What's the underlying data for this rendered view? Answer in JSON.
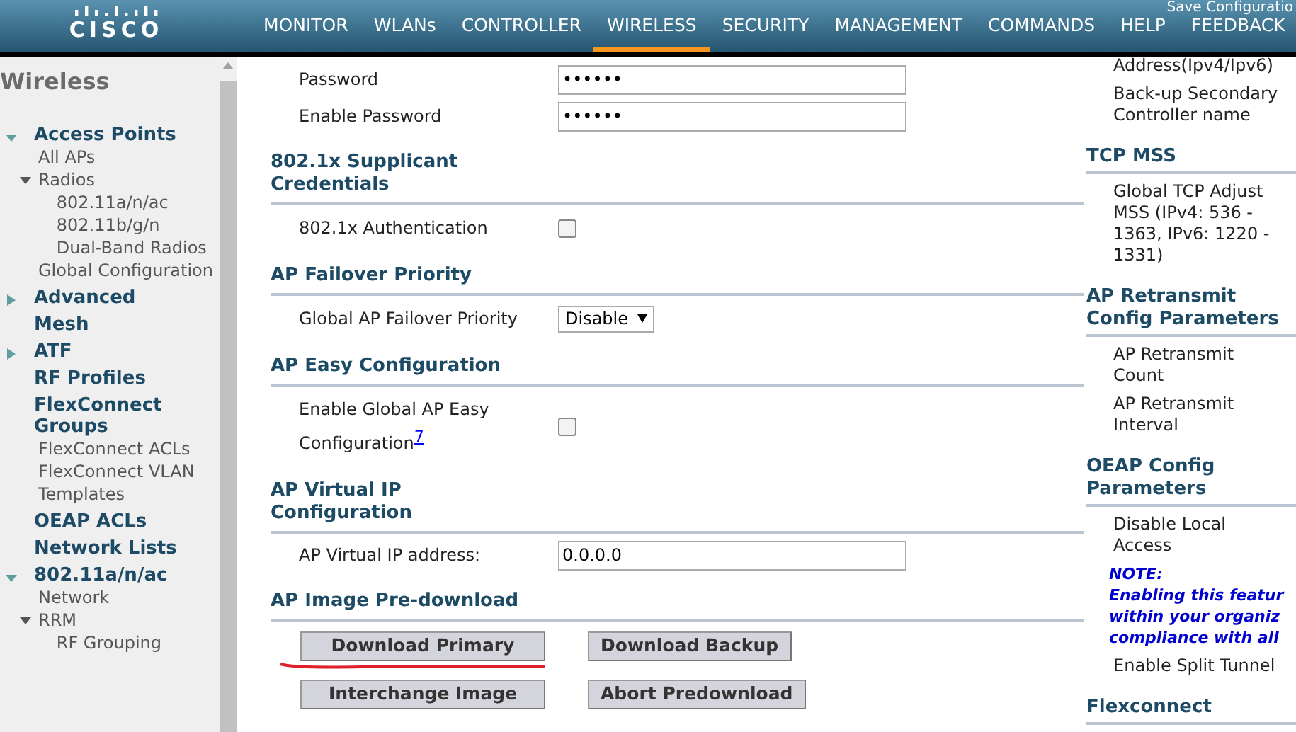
{
  "header": {
    "logo_text": "CISCO",
    "save_link": "Save Configuratio",
    "nav": [
      {
        "label": "MONITOR",
        "selected": false
      },
      {
        "label": "WLANs",
        "selected": false
      },
      {
        "label": "CONTROLLER",
        "selected": false
      },
      {
        "label": "WIRELESS",
        "selected": true
      },
      {
        "label": "SECURITY",
        "selected": false
      },
      {
        "label": "MANAGEMENT",
        "selected": false
      },
      {
        "label": "COMMANDS",
        "selected": false
      },
      {
        "label": "HELP",
        "selected": false
      },
      {
        "label": "FEEDBACK",
        "selected": false
      }
    ]
  },
  "sidebar": {
    "title": "Wireless",
    "items": [
      {
        "label": "Access Points",
        "expanded": true,
        "children": [
          {
            "label": "All APs"
          },
          {
            "label": "Radios",
            "expanded": true,
            "children": [
              {
                "label": "802.11a/n/ac"
              },
              {
                "label": "802.11b/g/n"
              },
              {
                "label": "Dual-Band Radios"
              }
            ]
          },
          {
            "label": "Global Configuration"
          }
        ]
      },
      {
        "label": "Advanced",
        "expanded": false
      },
      {
        "label": "Mesh"
      },
      {
        "label": "ATF",
        "expanded": false
      },
      {
        "label": "RF Profiles"
      },
      {
        "label": "FlexConnect Groups",
        "children": [
          {
            "label": "FlexConnect ACLs"
          },
          {
            "label": "FlexConnect VLAN Templates"
          }
        ]
      },
      {
        "label": "OEAP ACLs"
      },
      {
        "label": "Network Lists"
      },
      {
        "label": "802.11a/n/ac",
        "expanded": true,
        "children": [
          {
            "label": "Network"
          },
          {
            "label": "RRM",
            "expanded": true,
            "children": [
              {
                "label": "RF Grouping"
              }
            ]
          }
        ]
      }
    ]
  },
  "main_sections": [
    {
      "rows": [
        {
          "kind": "password",
          "label": "Password",
          "value": "••••••"
        },
        {
          "kind": "password",
          "label": "Enable Password",
          "value": "••••••"
        }
      ]
    },
    {
      "heading": "802.1x Supplicant Credentials",
      "rows": [
        {
          "kind": "checkbox",
          "label": "802.1x Authentication",
          "checked": false
        }
      ]
    },
    {
      "heading": "AP Failover Priority",
      "rows": [
        {
          "kind": "select",
          "label": "Global AP Failover Priority",
          "value": "Disable"
        }
      ]
    },
    {
      "heading": "AP Easy Configuration",
      "rows": [
        {
          "kind": "checkbox",
          "label": "Enable Global AP Easy Configuration",
          "footnote": "7",
          "checked": false
        }
      ]
    },
    {
      "heading": "AP Virtual IP Configuration",
      "rows": [
        {
          "kind": "text",
          "label": "AP Virtual IP address:",
          "value": "0.0.0.0"
        }
      ]
    },
    {
      "heading": "AP Image Pre-download",
      "rows": [
        {
          "kind": "buttons",
          "buttons": [
            "Download Primary",
            "Download Backup"
          ]
        },
        {
          "kind": "buttons",
          "buttons": [
            "Interchange Image",
            "Abort Predownload"
          ]
        }
      ]
    }
  ],
  "right_sections": [
    {
      "items": [
        {
          "kind": "label",
          "text": "Address(Ipv4/Ipv6)"
        },
        {
          "kind": "label",
          "text": "Back-up Secondary Controller name"
        }
      ]
    },
    {
      "heading": "TCP MSS",
      "items": [
        {
          "kind": "label",
          "text": "Global TCP Adjust MSS (IPv4: 536 - 1363, IPv6: 1220 - 1331)"
        }
      ]
    },
    {
      "heading": "AP Retransmit Config Parameters",
      "items": [
        {
          "kind": "label",
          "text": "AP Retransmit Count"
        },
        {
          "kind": "label",
          "text": "AP Retransmit Interval"
        }
      ]
    },
    {
      "heading": "OEAP Config Parameters",
      "items": [
        {
          "kind": "label",
          "text": "Disable Local Access"
        },
        {
          "kind": "note",
          "lines": [
            "NOTE:",
            "Enabling this featur",
            "within your organiz",
            "compliance with all"
          ]
        },
        {
          "kind": "label",
          "text": "Enable Split Tunnel"
        }
      ]
    },
    {
      "heading": "Flexconnect"
    }
  ]
}
